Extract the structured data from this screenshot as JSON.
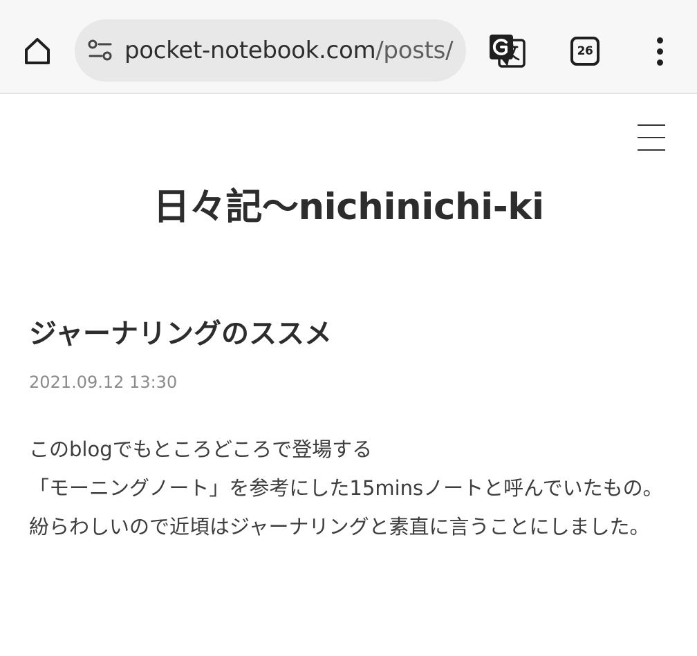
{
  "browser": {
    "url_host": "pocket-notebook.com",
    "url_path": "/posts/",
    "tab_count": "26",
    "icons": {
      "home": "home-icon",
      "site_info": "site-info-icon",
      "translate": "translate-icon",
      "tabs": "tab-switcher-icon",
      "menu": "more-vert-icon"
    }
  },
  "site": {
    "title": "日々記〜nichinichi-ki",
    "menu_icon": "hamburger-menu-icon"
  },
  "post": {
    "title": "ジャーナリングのススメ",
    "date": "2021.09.12 13:30",
    "paragraphs": [
      "このblogでもところどころで登場する",
      "「モーニングノート」を参考にした15minsノートと呼んでいたもの。",
      "紛らわしいので近頃はジャーナリングと素直に言うことにしました。"
    ]
  },
  "colors": {
    "toolbar_bg": "#f7f7f7",
    "urlbar_bg": "#e8e8e8",
    "text_dark": "#2d2d2d",
    "date_gray": "#8b8b8b"
  }
}
